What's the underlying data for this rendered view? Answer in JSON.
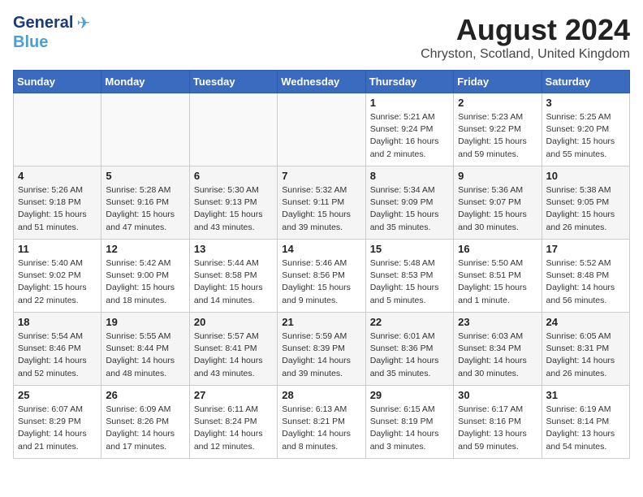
{
  "logo": {
    "line1": "General",
    "line2": "Blue"
  },
  "title": "August 2024",
  "subtitle": "Chryston, Scotland, United Kingdom",
  "headers": [
    "Sunday",
    "Monday",
    "Tuesday",
    "Wednesday",
    "Thursday",
    "Friday",
    "Saturday"
  ],
  "weeks": [
    [
      {
        "day": "",
        "info": ""
      },
      {
        "day": "",
        "info": ""
      },
      {
        "day": "",
        "info": ""
      },
      {
        "day": "",
        "info": ""
      },
      {
        "day": "1",
        "info": "Sunrise: 5:21 AM\nSunset: 9:24 PM\nDaylight: 16 hours\nand 2 minutes."
      },
      {
        "day": "2",
        "info": "Sunrise: 5:23 AM\nSunset: 9:22 PM\nDaylight: 15 hours\nand 59 minutes."
      },
      {
        "day": "3",
        "info": "Sunrise: 5:25 AM\nSunset: 9:20 PM\nDaylight: 15 hours\nand 55 minutes."
      }
    ],
    [
      {
        "day": "4",
        "info": "Sunrise: 5:26 AM\nSunset: 9:18 PM\nDaylight: 15 hours\nand 51 minutes."
      },
      {
        "day": "5",
        "info": "Sunrise: 5:28 AM\nSunset: 9:16 PM\nDaylight: 15 hours\nand 47 minutes."
      },
      {
        "day": "6",
        "info": "Sunrise: 5:30 AM\nSunset: 9:13 PM\nDaylight: 15 hours\nand 43 minutes."
      },
      {
        "day": "7",
        "info": "Sunrise: 5:32 AM\nSunset: 9:11 PM\nDaylight: 15 hours\nand 39 minutes."
      },
      {
        "day": "8",
        "info": "Sunrise: 5:34 AM\nSunset: 9:09 PM\nDaylight: 15 hours\nand 35 minutes."
      },
      {
        "day": "9",
        "info": "Sunrise: 5:36 AM\nSunset: 9:07 PM\nDaylight: 15 hours\nand 30 minutes."
      },
      {
        "day": "10",
        "info": "Sunrise: 5:38 AM\nSunset: 9:05 PM\nDaylight: 15 hours\nand 26 minutes."
      }
    ],
    [
      {
        "day": "11",
        "info": "Sunrise: 5:40 AM\nSunset: 9:02 PM\nDaylight: 15 hours\nand 22 minutes."
      },
      {
        "day": "12",
        "info": "Sunrise: 5:42 AM\nSunset: 9:00 PM\nDaylight: 15 hours\nand 18 minutes."
      },
      {
        "day": "13",
        "info": "Sunrise: 5:44 AM\nSunset: 8:58 PM\nDaylight: 15 hours\nand 14 minutes."
      },
      {
        "day": "14",
        "info": "Sunrise: 5:46 AM\nSunset: 8:56 PM\nDaylight: 15 hours\nand 9 minutes."
      },
      {
        "day": "15",
        "info": "Sunrise: 5:48 AM\nSunset: 8:53 PM\nDaylight: 15 hours\nand 5 minutes."
      },
      {
        "day": "16",
        "info": "Sunrise: 5:50 AM\nSunset: 8:51 PM\nDaylight: 15 hours\nand 1 minute."
      },
      {
        "day": "17",
        "info": "Sunrise: 5:52 AM\nSunset: 8:48 PM\nDaylight: 14 hours\nand 56 minutes."
      }
    ],
    [
      {
        "day": "18",
        "info": "Sunrise: 5:54 AM\nSunset: 8:46 PM\nDaylight: 14 hours\nand 52 minutes."
      },
      {
        "day": "19",
        "info": "Sunrise: 5:55 AM\nSunset: 8:44 PM\nDaylight: 14 hours\nand 48 minutes."
      },
      {
        "day": "20",
        "info": "Sunrise: 5:57 AM\nSunset: 8:41 PM\nDaylight: 14 hours\nand 43 minutes."
      },
      {
        "day": "21",
        "info": "Sunrise: 5:59 AM\nSunset: 8:39 PM\nDaylight: 14 hours\nand 39 minutes."
      },
      {
        "day": "22",
        "info": "Sunrise: 6:01 AM\nSunset: 8:36 PM\nDaylight: 14 hours\nand 35 minutes."
      },
      {
        "day": "23",
        "info": "Sunrise: 6:03 AM\nSunset: 8:34 PM\nDaylight: 14 hours\nand 30 minutes."
      },
      {
        "day": "24",
        "info": "Sunrise: 6:05 AM\nSunset: 8:31 PM\nDaylight: 14 hours\nand 26 minutes."
      }
    ],
    [
      {
        "day": "25",
        "info": "Sunrise: 6:07 AM\nSunset: 8:29 PM\nDaylight: 14 hours\nand 21 minutes."
      },
      {
        "day": "26",
        "info": "Sunrise: 6:09 AM\nSunset: 8:26 PM\nDaylight: 14 hours\nand 17 minutes."
      },
      {
        "day": "27",
        "info": "Sunrise: 6:11 AM\nSunset: 8:24 PM\nDaylight: 14 hours\nand 12 minutes."
      },
      {
        "day": "28",
        "info": "Sunrise: 6:13 AM\nSunset: 8:21 PM\nDaylight: 14 hours\nand 8 minutes."
      },
      {
        "day": "29",
        "info": "Sunrise: 6:15 AM\nSunset: 8:19 PM\nDaylight: 14 hours\nand 3 minutes."
      },
      {
        "day": "30",
        "info": "Sunrise: 6:17 AM\nSunset: 8:16 PM\nDaylight: 13 hours\nand 59 minutes."
      },
      {
        "day": "31",
        "info": "Sunrise: 6:19 AM\nSunset: 8:14 PM\nDaylight: 13 hours\nand 54 minutes."
      }
    ]
  ]
}
